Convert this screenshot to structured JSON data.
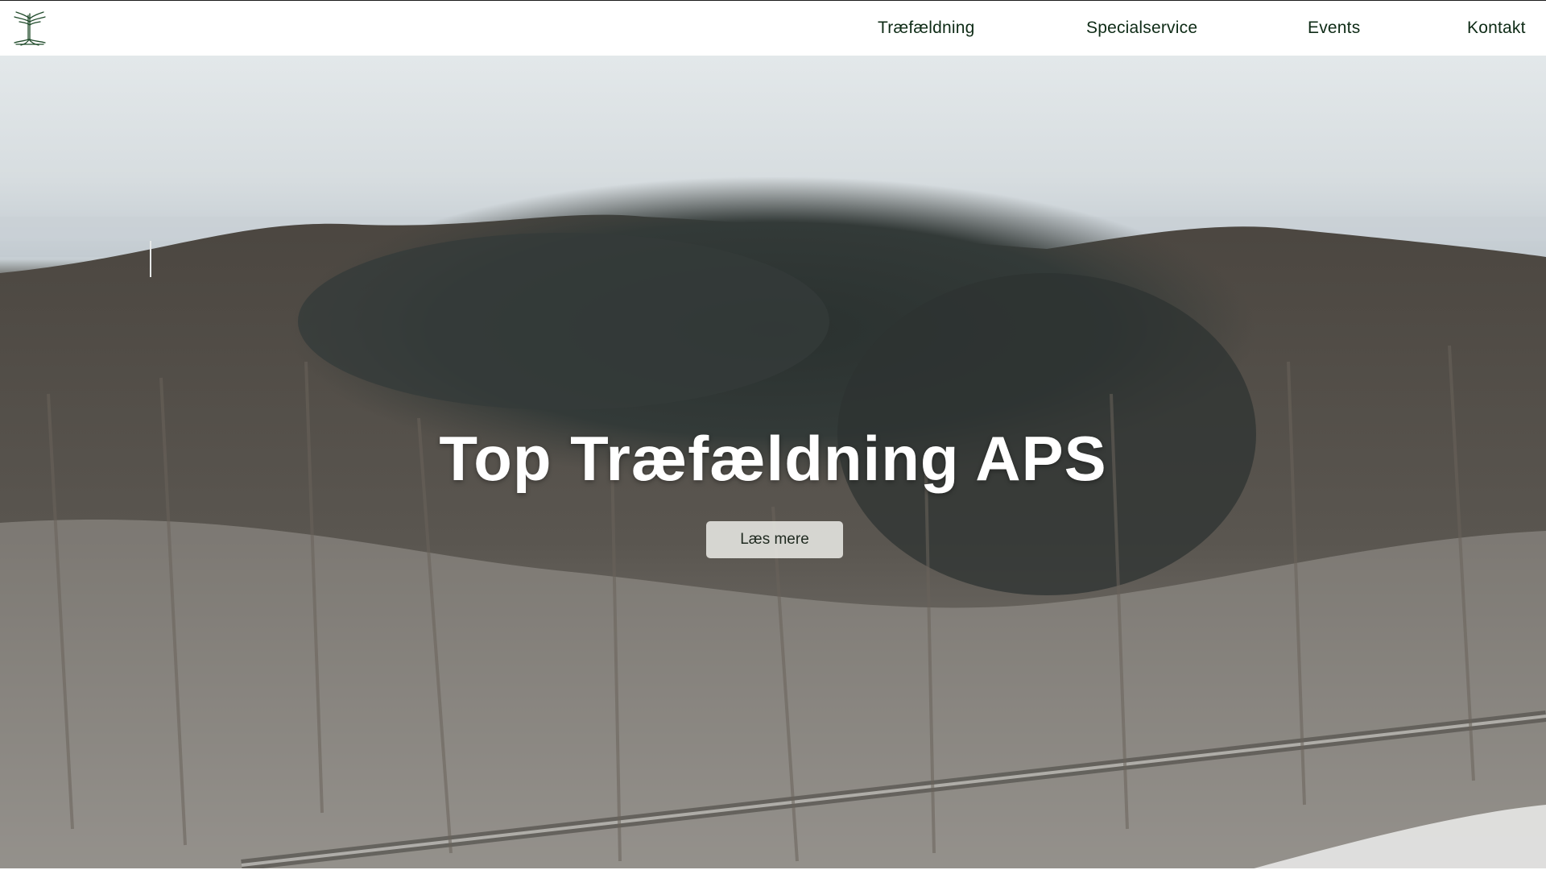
{
  "header": {
    "logo_icon": "tree-roots-logo",
    "nav": [
      {
        "label": "Træfældning"
      },
      {
        "label": "Specialservice"
      },
      {
        "label": "Events"
      },
      {
        "label": "Kontakt"
      }
    ]
  },
  "hero": {
    "title": "Top Træfældning APS",
    "button_label": "Læs mere"
  },
  "colors": {
    "nav_text": "#0e2b16",
    "title_text": "#ffffff",
    "button_bg": "#ececE8"
  }
}
